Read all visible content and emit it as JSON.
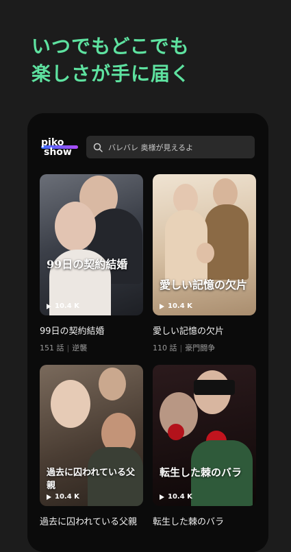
{
  "headline": {
    "line1": "いつでもどこでも",
    "line2": "楽しさが手に届く"
  },
  "logo": {
    "line1": "piko",
    "line2": "show"
  },
  "search": {
    "placeholder": "バレバレ 奥様が見えるよ"
  },
  "dramas": [
    {
      "title": "99日の契約結婚",
      "episodes": "151 話",
      "genre": "逆襲",
      "views": "10.4 K",
      "poster_text": "99日の契約結婚"
    },
    {
      "title": "愛しい記憶の欠片",
      "episodes": "110 話",
      "genre": "豪門闘争",
      "views": "10.4 K",
      "poster_text": "愛しい記憶の欠片"
    },
    {
      "title": "過去に囚われている父親",
      "episodes": "",
      "genre": "",
      "views": "10.4 K",
      "poster_text": "過去に囚われている父親"
    },
    {
      "title": "転生した棘のバラ",
      "episodes": "",
      "genre": "",
      "views": "10.4 K",
      "poster_text": "転生した棘のバラ"
    }
  ],
  "colors": {
    "accent": "#5ee2a0",
    "background": "#1c1c1c",
    "panel": "#0b0b0b"
  }
}
